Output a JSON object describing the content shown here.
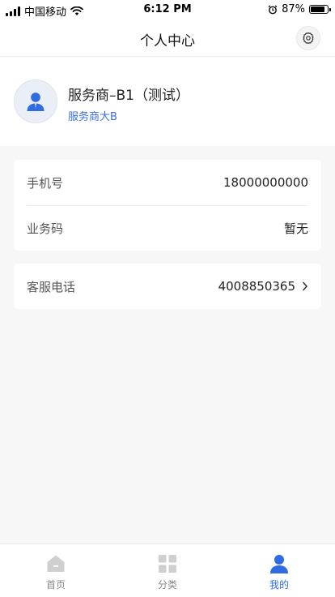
{
  "status_bar": {
    "carrier": "中国移动",
    "time": "6:12 PM",
    "battery": "87%",
    "battery_level": 0.87
  },
  "nav": {
    "title": "个人中心",
    "settings_icon": "gear-icon"
  },
  "profile": {
    "name": "服务商–B1（测试）",
    "company": "服务商大B",
    "avatar_icon": "user-avatar-icon"
  },
  "info": {
    "phone_label": "手机号",
    "phone_value": "18000000000",
    "code_label": "业务码",
    "code_value": "暂无"
  },
  "service": {
    "label": "客服电话",
    "value": "4008850365",
    "arrow_icon": "chevron-right-icon"
  },
  "tabs": [
    {
      "label": "首页",
      "icon": "home-icon"
    },
    {
      "label": "分类",
      "icon": "grid-icon"
    },
    {
      "label": "我的",
      "icon": "person-icon"
    }
  ],
  "colors": {
    "accent": "#2f6be3",
    "background": "#f7f7f7",
    "tab_inactive": "#888888"
  }
}
